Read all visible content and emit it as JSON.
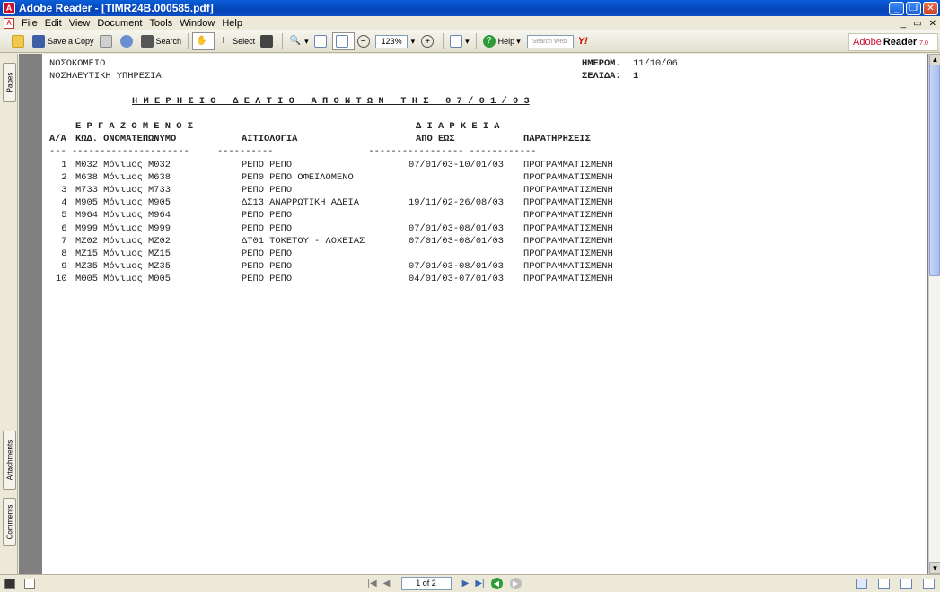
{
  "window": {
    "title": "Adobe Reader - [TIMR24B.000585.pdf]",
    "app_icon_glyph": "A"
  },
  "menu": {
    "items": [
      "File",
      "Edit",
      "View",
      "Document",
      "Tools",
      "Window",
      "Help"
    ],
    "mdi_controls": [
      "_",
      "▭",
      "✕"
    ]
  },
  "toolbar": {
    "save_copy": "Save a Copy",
    "search": "Search",
    "select": "Select",
    "zoom_value": "123%",
    "help": "Help",
    "search_web_placeholder": "Search Web",
    "yahoo": "Y!"
  },
  "brand": {
    "adobe": "Adobe",
    "reader": "Reader",
    "version": "7.0"
  },
  "nav_panel": {
    "tabs": [
      "Pages",
      "Attachments",
      "Comments"
    ]
  },
  "document": {
    "header_left_1": "ΝΟΣΟΚΟΜΕΙΟ",
    "header_left_2": "ΝΟΣΗΛΕΥΤΙΚΗ ΥΠΗΡΕΣΙΑ",
    "date_label": "ΗΜΕΡΟΜ.",
    "date_value": "11/10/06",
    "page_label": "ΣΕΛΙΔΑ:",
    "page_value": "1",
    "report_title": "Η Μ Ε Ρ Η Σ Ι Ο   Δ Ε Λ Τ Ι Ο   Α Π Ο Ν Τ Ω Ν   Τ Η Σ   0 7 / 0 1 / 0 3",
    "group_employee": "Ε Ρ Γ Α Ζ Ο Μ Ε Ν Ο Σ",
    "group_duration": "Δ Ι Α Ρ Κ Ε Ι Α",
    "col_aa": "Α/Α",
    "col_code_name": "ΚΩΔ. ΟΝΟΜΑΤΕΠΩΝΥΜΟ",
    "col_reason": "ΑΙΤΙΟΛΟΓΙΑ",
    "col_from_to": "ΑΠΟ ΕΩΣ",
    "col_notes": "ΠΑΡΑΤΗΡΗΣΕΙΣ",
    "underline_row": "--- ---------------------     ----------                 ----------------- ------------",
    "rows": [
      {
        "aa": " 1",
        "code_name": "M032 Μόνιμος M032",
        "reason": "ΡΕΠΟ ΡΕΠΟ",
        "period": "07/01/03-10/01/03",
        "notes": "ΠΡΟΓΡΑΜΜΑΤΙΣΜΕΝΗ"
      },
      {
        "aa": " 2",
        "code_name": "M638 Μόνιμος M638",
        "reason": "ΡΕΠ0 ΡΕΠΟ ΟΦΕΙΛΟΜΕΝΟ",
        "period": "",
        "notes": "ΠΡΟΓΡΑΜΜΑΤΙΣΜΕΝΗ"
      },
      {
        "aa": " 3",
        "code_name": "M733 Μόνιμος M733",
        "reason": "ΡΕΠΟ ΡΕΠΟ",
        "period": "",
        "notes": "ΠΡΟΓΡΑΜΜΑΤΙΣΜΕΝΗ"
      },
      {
        "aa": " 4",
        "code_name": "M905 Μόνιμος M905",
        "reason": "ΔΣ13 ΑΝΑΡΡΩΤΙΚΗ ΑΔΕΙΑ",
        "period": "19/11/02-26/08/03",
        "notes": "ΠΡΟΓΡΑΜΜΑΤΙΣΜΕΝΗ"
      },
      {
        "aa": " 5",
        "code_name": "M964 Μόνιμος M964",
        "reason": "ΡΕΠΟ ΡΕΠΟ",
        "period": "",
        "notes": "ΠΡΟΓΡΑΜΜΑΤΙΣΜΕΝΗ"
      },
      {
        "aa": " 6",
        "code_name": "M999 Μόνιμος M999",
        "reason": "ΡΕΠΟ ΡΕΠΟ",
        "period": "07/01/03-08/01/03",
        "notes": "ΠΡΟΓΡΑΜΜΑΤΙΣΜΕΝΗ"
      },
      {
        "aa": " 7",
        "code_name": "MZ02 Μόνιμος MZ02",
        "reason": "ΔΤ01 ΤΟΚΕΤΟΥ - ΛΟΧΕΙΑΣ",
        "period": "07/01/03-08/01/03",
        "notes": "ΠΡΟΓΡΑΜΜΑΤΙΣΜΕΝΗ"
      },
      {
        "aa": " 8",
        "code_name": "MZ15 Μόνιμος MZ15",
        "reason": "ΡΕΠΟ ΡΕΠΟ",
        "period": "",
        "notes": "ΠΡΟΓΡΑΜΜΑΤΙΣΜΕΝΗ"
      },
      {
        "aa": " 9",
        "code_name": "MZ35 Μόνιμος MZ35",
        "reason": "ΡΕΠΟ ΡΕΠΟ",
        "period": "07/01/03-08/01/03",
        "notes": "ΠΡΟΓΡΑΜΜΑΤΙΣΜΕΝΗ"
      },
      {
        "aa": "10",
        "code_name": "MΘ05 Μόνιμος MΘ05",
        "reason": "ΡΕΠΟ ΡΕΠΟ",
        "period": "04/01/03-07/01/03",
        "notes": "ΠΡΟΓΡΑΜΜΑΤΙΣΜΕΝΗ"
      }
    ]
  },
  "status": {
    "page_indicator": "1 of 2"
  },
  "colors": {
    "titlebar": "#0443b8",
    "workspace": "#808080",
    "adobe_red": "#c8102e"
  }
}
